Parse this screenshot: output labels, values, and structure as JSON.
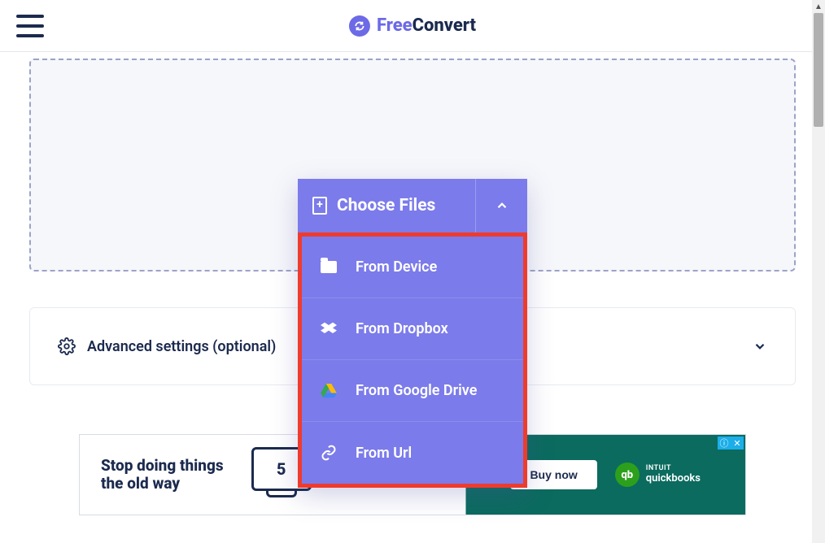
{
  "header": {
    "logo_free": "Free",
    "logo_convert": "Convert"
  },
  "choose": {
    "label": "Choose Files"
  },
  "dropdown": {
    "items": [
      {
        "label": "From Device"
      },
      {
        "label": "From Dropbox"
      },
      {
        "label": "From Google Drive"
      },
      {
        "label": "From Url"
      }
    ]
  },
  "advanced": {
    "label": "Advanced settings (optional)"
  },
  "ad": {
    "headline_l1": "Stop doing things",
    "headline_l2": "the old way",
    "monitor_number": "5",
    "buy_label": "Buy now",
    "brand_top": "INTUIT",
    "brand_bottom": "quickbooks",
    "brand_glyph": "qb",
    "info_glyph": "ⓘ",
    "close_glyph": "✕"
  }
}
